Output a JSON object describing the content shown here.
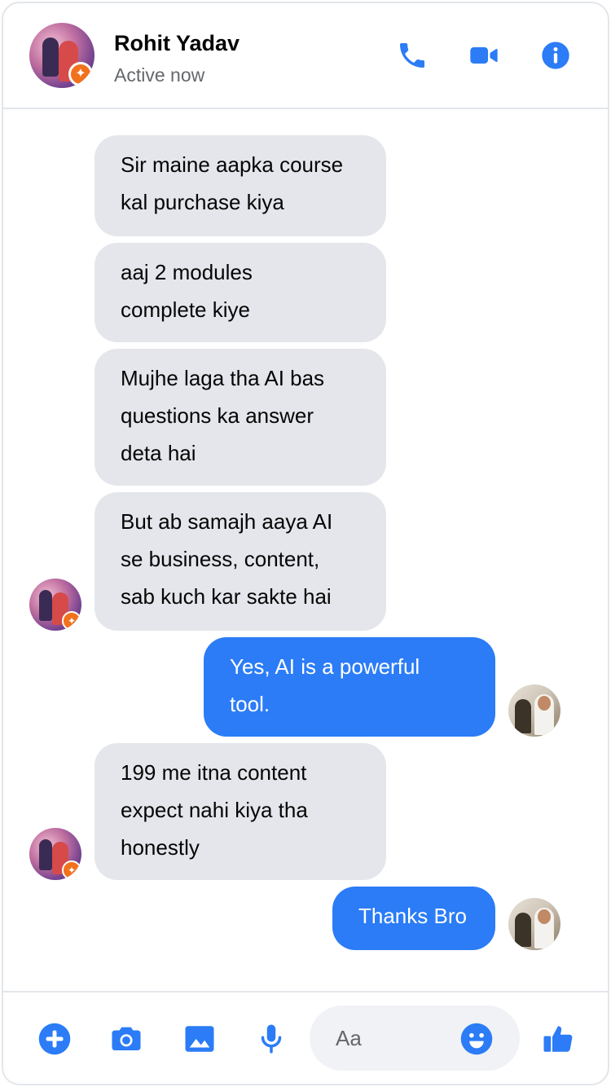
{
  "header": {
    "name": "Rohit Yadav",
    "status": "Active now",
    "icons": [
      "phone-icon",
      "video-icon",
      "info-icon"
    ]
  },
  "messages": [
    {
      "sender": "them",
      "text": "Sir maine aapka course\nkal purchase kiya"
    },
    {
      "sender": "them",
      "text": "aaj 2 modules\ncomplete kiye"
    },
    {
      "sender": "them",
      "text": "Mujhe laga tha AI bas\nquestions ka answer\ndeta hai"
    },
    {
      "sender": "them",
      "text": "But ab samajh aaya AI\nse business, content,\nsab kuch kar sakte hai"
    },
    {
      "sender": "me",
      "text": "Yes, AI is a powerful\ntool."
    },
    {
      "sender": "them",
      "text": "199 me itna content\nexpect nahi kiya tha\nhonestly"
    },
    {
      "sender": "me",
      "text": "Thanks Bro"
    }
  ],
  "composer": {
    "placeholder": "Aa",
    "icons": [
      "plus-icon",
      "camera-icon",
      "image-icon",
      "mic-icon",
      "emoji-icon",
      "thumbs-up-icon"
    ]
  },
  "colors": {
    "accent": "#2b7cf6",
    "incoming_bubble": "#e4e6eb",
    "outgoing_bubble": "#2b7cf6",
    "secondary_text": "#65676b"
  }
}
